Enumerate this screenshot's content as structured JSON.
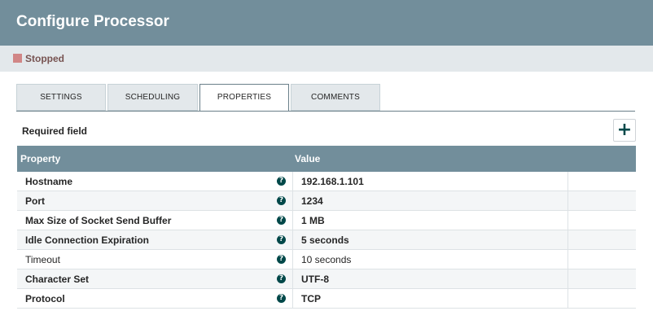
{
  "dialog": {
    "title": "Configure Processor",
    "status": "Stopped",
    "status_color": "#d18686"
  },
  "tabs": [
    {
      "label": "SETTINGS",
      "active": false
    },
    {
      "label": "SCHEDULING",
      "active": false
    },
    {
      "label": "PROPERTIES",
      "active": true
    },
    {
      "label": "COMMENTS",
      "active": false
    }
  ],
  "properties": {
    "required_label": "Required field",
    "add_icon": "plus-icon",
    "add_symbol": "+",
    "help_icon": "question-circle-icon",
    "help_symbol": "?",
    "columns": {
      "property": "Property",
      "value": "Value"
    },
    "rows": [
      {
        "name": "Hostname",
        "value": "192.168.1.101",
        "required": true
      },
      {
        "name": "Port",
        "value": "1234",
        "required": true
      },
      {
        "name": "Max Size of Socket Send Buffer",
        "value": "1 MB",
        "required": true
      },
      {
        "name": "Idle Connection Expiration",
        "value": "5 seconds",
        "required": true
      },
      {
        "name": "Timeout",
        "value": "10 seconds",
        "required": false
      },
      {
        "name": "Character Set",
        "value": "UTF-8",
        "required": true
      },
      {
        "name": "Protocol",
        "value": "TCP",
        "required": true
      }
    ]
  },
  "colors": {
    "header": "#728e9b",
    "status_bar": "#e3e8eb",
    "accent": "#004849"
  }
}
